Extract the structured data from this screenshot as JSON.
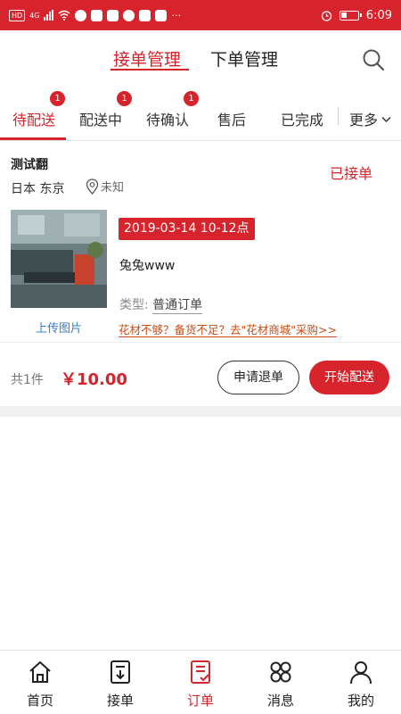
{
  "status_bar": {
    "left_chip": "HD",
    "net": "4G",
    "time": "6:09",
    "dots": "···"
  },
  "header": {
    "tabs": [
      {
        "label": "接单管理",
        "active": true
      },
      {
        "label": "下单管理",
        "active": false
      }
    ],
    "search_icon": "search-icon"
  },
  "subtabs": {
    "items": [
      {
        "label": "待配送",
        "badge": "1",
        "active": true
      },
      {
        "label": "配送中",
        "badge": "1",
        "active": false
      },
      {
        "label": "待确认",
        "badge": "1",
        "active": false
      },
      {
        "label": "售后",
        "active": false
      },
      {
        "label": "已完成",
        "active": false
      }
    ],
    "more_label": "更多",
    "more_icon": "chevron-down-icon"
  },
  "order": {
    "customer": "测试翻",
    "status": "已接单",
    "address": "日本 东京",
    "location_icon": "location-pin-icon",
    "location": "未知",
    "upload_label": "上传图片",
    "delivery_time": "2019-03-14  10-12点",
    "product": "兔兔www",
    "type_label": "类型:",
    "type_value": "普通订单",
    "promo": "花材不够？备货不足？去\"花材商城\"采购>>",
    "item_count": "共1件",
    "total": "￥10.00",
    "refund_button": "申请退单",
    "deliver_button": "开始配送"
  },
  "tabbar": {
    "items": [
      {
        "label": "首页",
        "icon": "home-icon",
        "active": false
      },
      {
        "label": "接单",
        "icon": "receive-order-icon",
        "active": false
      },
      {
        "label": "订单",
        "icon": "order-list-icon",
        "active": true
      },
      {
        "label": "消息",
        "icon": "message-icon",
        "active": false
      },
      {
        "label": "我的",
        "icon": "profile-icon",
        "active": false
      }
    ]
  },
  "colors": {
    "accent": "#d6232c",
    "link": "#3a7dc4",
    "promo": "#c84b12"
  }
}
